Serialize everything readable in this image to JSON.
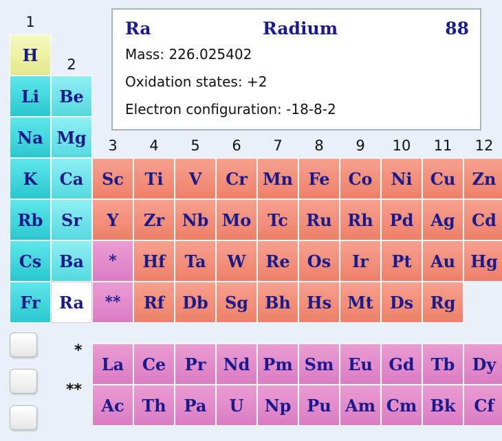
{
  "group_labels": [
    "1",
    "2",
    "3",
    "4",
    "5",
    "6",
    "7",
    "8",
    "9",
    "10",
    "11",
    "12"
  ],
  "info": {
    "symbol": "Ra",
    "name": "Radium",
    "number": "88",
    "mass": "Mass: 226.025402",
    "oxidation": "Oxidation states: +2",
    "configuration": "Electron configuration: -18-8-2"
  },
  "series_marks": {
    "lanthanides": "*",
    "actinides": "**"
  },
  "elements": [
    {
      "symbol": "H",
      "category": "hydrogen",
      "period": 1,
      "group": 1
    },
    {
      "symbol": "Li",
      "category": "alkali",
      "period": 2,
      "group": 1
    },
    {
      "symbol": "Be",
      "category": "alkaline",
      "period": 2,
      "group": 2
    },
    {
      "symbol": "Na",
      "category": "alkali",
      "period": 3,
      "group": 1
    },
    {
      "symbol": "Mg",
      "category": "alkaline",
      "period": 3,
      "group": 2
    },
    {
      "symbol": "K",
      "category": "alkali",
      "period": 4,
      "group": 1
    },
    {
      "symbol": "Ca",
      "category": "alkaline",
      "period": 4,
      "group": 2
    },
    {
      "symbol": "Sc",
      "category": "transition",
      "period": 4,
      "group": 3
    },
    {
      "symbol": "Ti",
      "category": "transition",
      "period": 4,
      "group": 4
    },
    {
      "symbol": "V",
      "category": "transition",
      "period": 4,
      "group": 5
    },
    {
      "symbol": "Cr",
      "category": "transition",
      "period": 4,
      "group": 6
    },
    {
      "symbol": "Mn",
      "category": "transition",
      "period": 4,
      "group": 7
    },
    {
      "symbol": "Fe",
      "category": "transition",
      "period": 4,
      "group": 8
    },
    {
      "symbol": "Co",
      "category": "transition",
      "period": 4,
      "group": 9
    },
    {
      "symbol": "Ni",
      "category": "transition",
      "period": 4,
      "group": 10
    },
    {
      "symbol": "Cu",
      "category": "transition",
      "period": 4,
      "group": 11
    },
    {
      "symbol": "Zn",
      "category": "transition",
      "period": 4,
      "group": 12
    },
    {
      "symbol": "Rb",
      "category": "alkali",
      "period": 5,
      "group": 1
    },
    {
      "symbol": "Sr",
      "category": "alkaline",
      "period": 5,
      "group": 2
    },
    {
      "symbol": "Y",
      "category": "transition",
      "period": 5,
      "group": 3
    },
    {
      "symbol": "Zr",
      "category": "transition",
      "period": 5,
      "group": 4
    },
    {
      "symbol": "Nb",
      "category": "transition",
      "period": 5,
      "group": 5
    },
    {
      "symbol": "Mo",
      "category": "transition",
      "period": 5,
      "group": 6
    },
    {
      "symbol": "Tc",
      "category": "transition",
      "period": 5,
      "group": 7
    },
    {
      "symbol": "Ru",
      "category": "transition",
      "period": 5,
      "group": 8
    },
    {
      "symbol": "Rh",
      "category": "transition",
      "period": 5,
      "group": 9
    },
    {
      "symbol": "Pd",
      "category": "transition",
      "period": 5,
      "group": 10
    },
    {
      "symbol": "Ag",
      "category": "transition",
      "period": 5,
      "group": 11
    },
    {
      "symbol": "Cd",
      "category": "transition",
      "period": 5,
      "group": 12
    },
    {
      "symbol": "Cs",
      "category": "alkali",
      "period": 6,
      "group": 1
    },
    {
      "symbol": "Ba",
      "category": "alkaline",
      "period": 6,
      "group": 2
    },
    {
      "symbol": "*",
      "category": "lanth",
      "period": 6,
      "group": 3
    },
    {
      "symbol": "Hf",
      "category": "transition",
      "period": 6,
      "group": 4
    },
    {
      "symbol": "Ta",
      "category": "transition",
      "period": 6,
      "group": 5
    },
    {
      "symbol": "W",
      "category": "transition",
      "period": 6,
      "group": 6
    },
    {
      "symbol": "Re",
      "category": "transition",
      "period": 6,
      "group": 7
    },
    {
      "symbol": "Os",
      "category": "transition",
      "period": 6,
      "group": 8
    },
    {
      "symbol": "Ir",
      "category": "transition",
      "period": 6,
      "group": 9
    },
    {
      "symbol": "Pt",
      "category": "transition",
      "period": 6,
      "group": 10
    },
    {
      "symbol": "Au",
      "category": "transition",
      "period": 6,
      "group": 11
    },
    {
      "symbol": "Hg",
      "category": "transition",
      "period": 6,
      "group": 12
    },
    {
      "symbol": "Fr",
      "category": "alkali",
      "period": 7,
      "group": 1
    },
    {
      "symbol": "Ra",
      "category": "alkaline",
      "period": 7,
      "group": 2,
      "selected": true
    },
    {
      "symbol": "**",
      "category": "lanth",
      "period": 7,
      "group": 3
    },
    {
      "symbol": "Rf",
      "category": "transition",
      "period": 7,
      "group": 4
    },
    {
      "symbol": "Db",
      "category": "transition",
      "period": 7,
      "group": 5
    },
    {
      "symbol": "Sg",
      "category": "transition",
      "period": 7,
      "group": 6
    },
    {
      "symbol": "Bh",
      "category": "transition",
      "period": 7,
      "group": 7
    },
    {
      "symbol": "Hs",
      "category": "transition",
      "period": 7,
      "group": 8
    },
    {
      "symbol": "Mt",
      "category": "transition",
      "period": 7,
      "group": 9
    },
    {
      "symbol": "Ds",
      "category": "transition",
      "period": 7,
      "group": 10
    },
    {
      "symbol": "Rg",
      "category": "transition",
      "period": 7,
      "group": 11
    }
  ],
  "lanthanides": [
    "La",
    "Ce",
    "Pr",
    "Nd",
    "Pm",
    "Sm",
    "Eu",
    "Gd",
    "Tb",
    "Dy"
  ],
  "actinides": [
    "Ac",
    "Th",
    "Pa",
    "U",
    "Np",
    "Pu",
    "Am",
    "Cm",
    "Bk",
    "Cf"
  ],
  "side_buttons": 3
}
